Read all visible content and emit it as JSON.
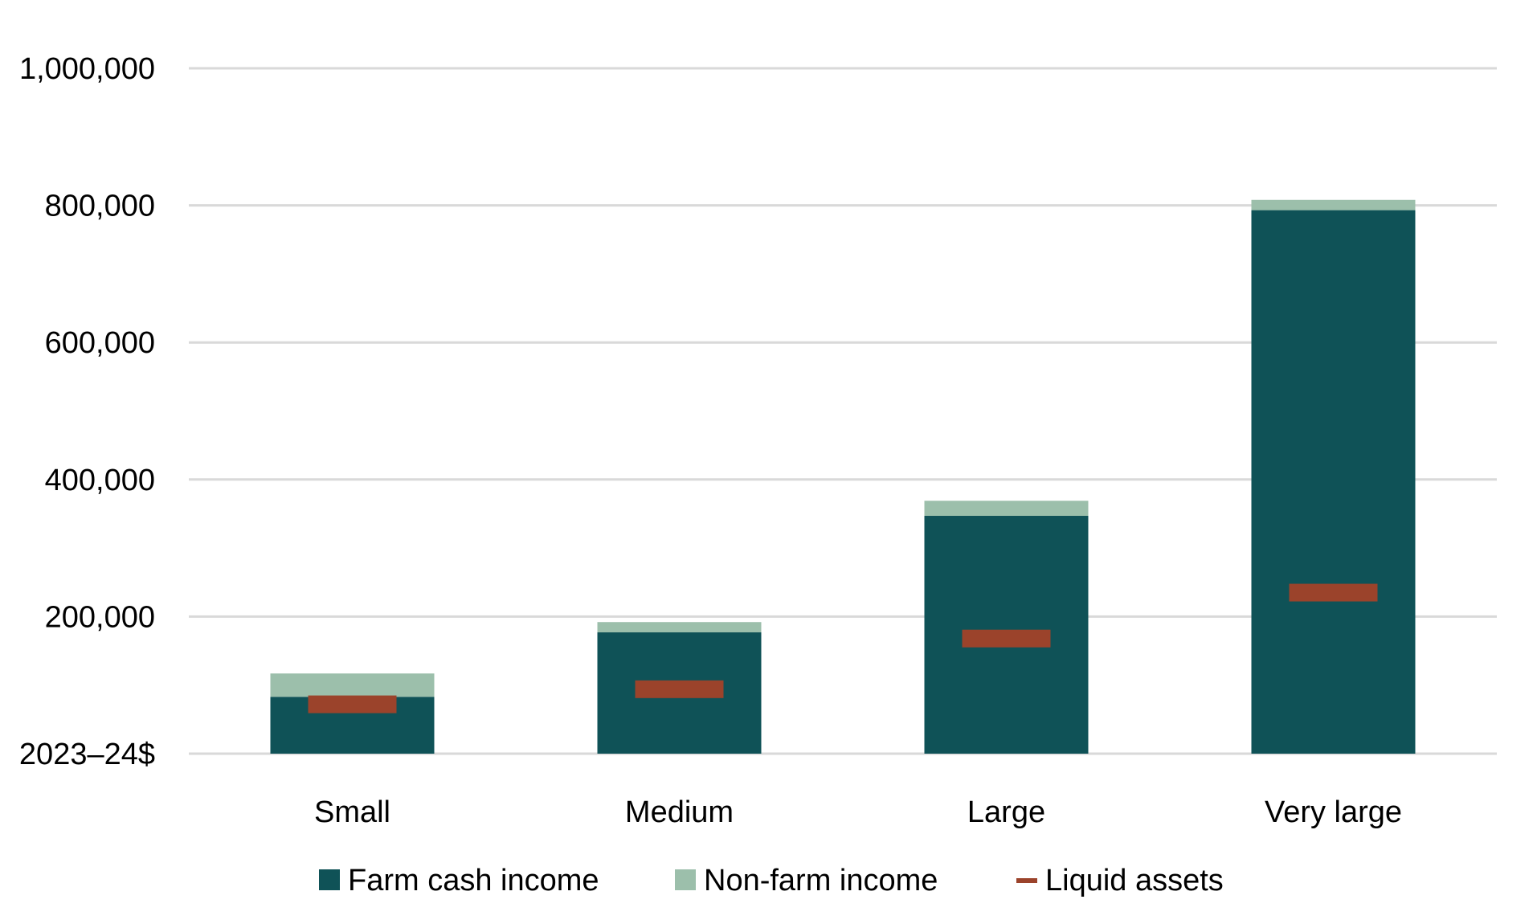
{
  "chart_data": {
    "type": "bar",
    "stacked": true,
    "title": "",
    "xlabel": "",
    "ylabel": "2023–24$",
    "ylim": [
      0,
      1000000
    ],
    "yticks": [
      0,
      200000,
      400000,
      600000,
      800000,
      1000000
    ],
    "ytick_labels": [
      "2023–24$",
      "200,000",
      "400,000",
      "600,000",
      "800,000",
      "1,000,000"
    ],
    "grid": true,
    "legend_position": "bottom",
    "categories": [
      "Small",
      "Medium",
      "Large",
      "Very large"
    ],
    "series": [
      {
        "name": "Farm cash income",
        "kind": "bar",
        "color": "#0f5257",
        "values": [
          83000,
          177000,
          347000,
          793000
        ]
      },
      {
        "name": "Non-farm income",
        "kind": "bar",
        "color": "#9cbfab",
        "values": [
          34000,
          15000,
          22000,
          15000
        ]
      },
      {
        "name": "Liquid assets",
        "kind": "marker",
        "color": "#9b432b",
        "values": [
          72000,
          94000,
          168000,
          235000
        ]
      }
    ]
  }
}
